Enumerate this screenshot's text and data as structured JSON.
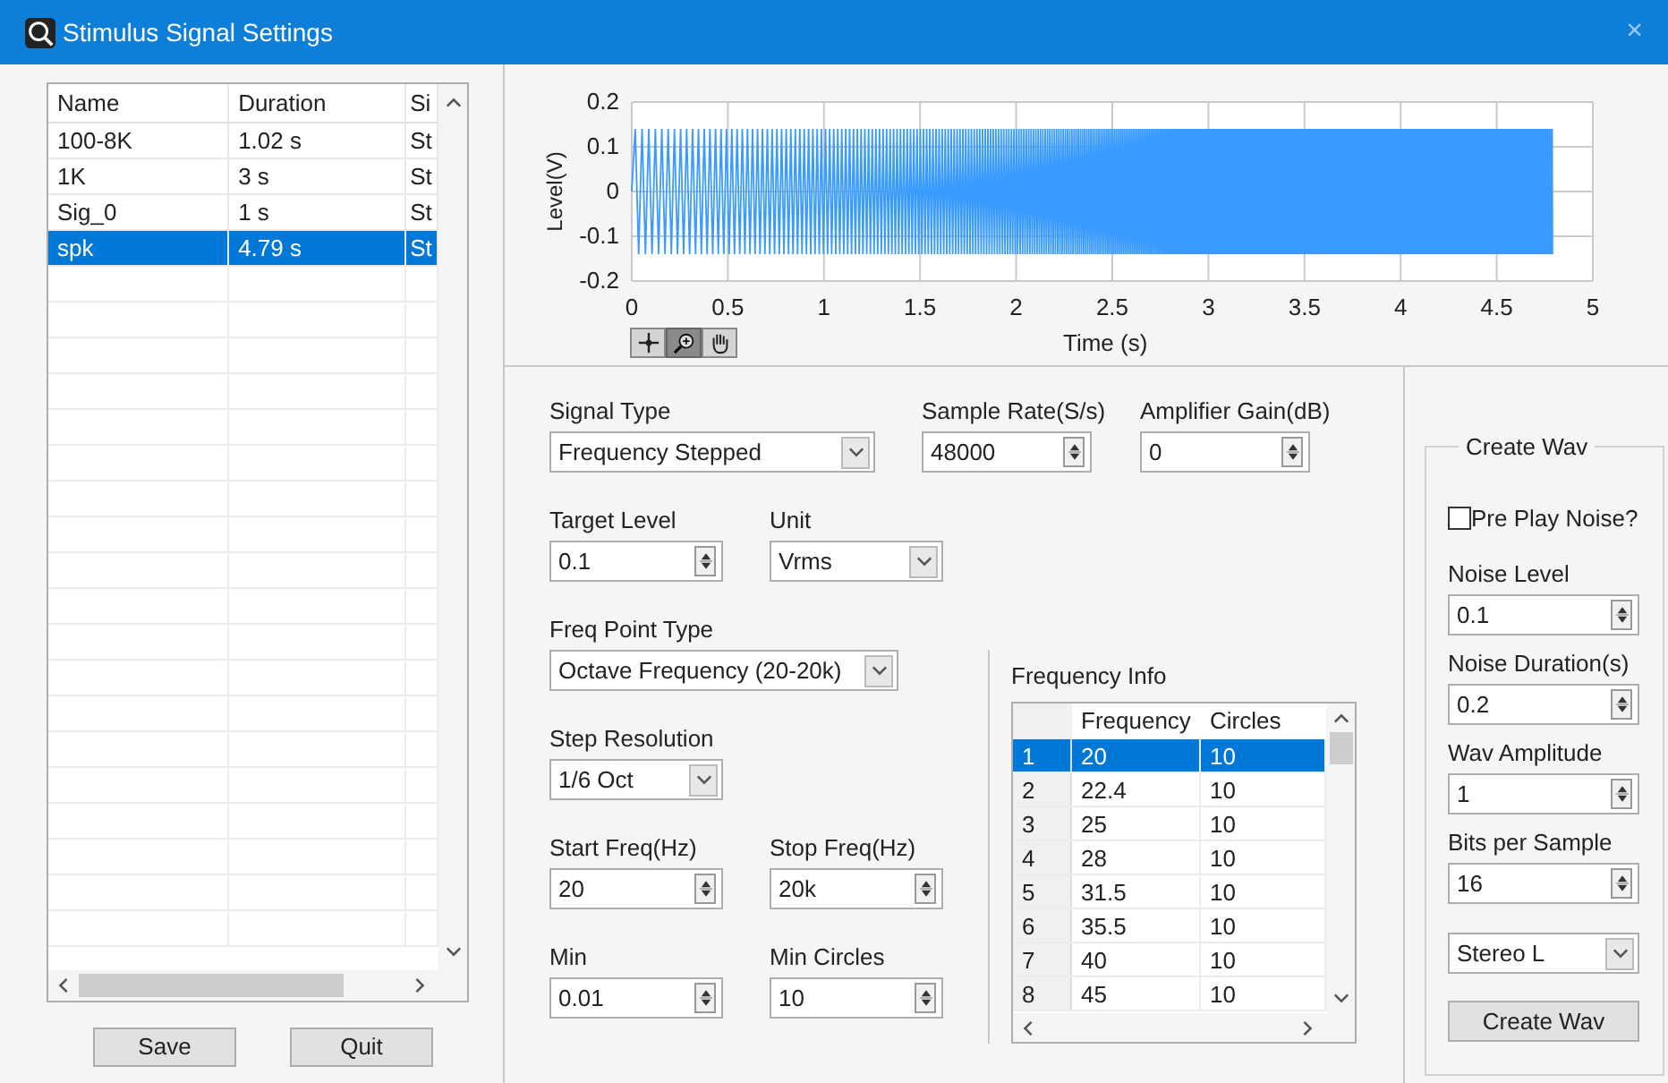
{
  "window": {
    "title": "Stimulus Signal Settings",
    "close": "×"
  },
  "signal_list": {
    "columns": [
      "Name",
      "Duration",
      "Si"
    ],
    "rows": [
      {
        "cells": [
          "100-8K",
          "1.02 s",
          "St"
        ],
        "selected": false
      },
      {
        "cells": [
          "1K",
          "3 s",
          "St"
        ],
        "selected": false
      },
      {
        "cells": [
          "Sig_0",
          "1 s",
          "St"
        ],
        "selected": false
      },
      {
        "cells": [
          "spk",
          "4.79 s",
          "St"
        ],
        "selected": true
      }
    ]
  },
  "buttons": [
    "Save",
    "Quit"
  ],
  "graph": {
    "ylabel": "Level(V)",
    "xlabel": "Time (s)",
    "yticks": [
      "0.2",
      "0.1",
      "0",
      "-0.1",
      "-0.2"
    ],
    "xticks": [
      "0",
      "0.5",
      "1",
      "1.5",
      "2",
      "2.5",
      "3",
      "3.5",
      "4",
      "4.5",
      "5"
    ]
  },
  "form": {
    "rows": [
      [
        {
          "kind": "dropdown",
          "label": "Signal Type",
          "value": "Frequency Stepped"
        },
        {
          "kind": "spinner",
          "label": "Sample Rate(S/s)",
          "value": "48000"
        },
        {
          "kind": "spinner",
          "label": "Amplifier Gain(dB)",
          "value": "0"
        }
      ],
      [
        {
          "kind": "spinner",
          "label": "Target Level",
          "value": "0.1"
        },
        {
          "kind": "dropdown",
          "label": "Unit",
          "value": "Vrms"
        }
      ],
      [
        {
          "kind": "dropdown",
          "label": "Freq Point Type",
          "value": "Octave Frequency (20-20k)"
        }
      ],
      [
        {
          "kind": "dropdown",
          "label": "Step Resolution",
          "value": "1/6 Oct"
        }
      ],
      [
        {
          "kind": "spinner",
          "label": "Start Freq(Hz)",
          "value": "20"
        },
        {
          "kind": "spinner",
          "label": "Stop Freq(Hz)",
          "value": "20k"
        }
      ],
      [
        {
          "kind": "spinner",
          "label": "Min",
          "value": "0.01"
        },
        {
          "kind": "spinner",
          "label": "Min Circles",
          "value": "10"
        }
      ]
    ]
  },
  "frequency_info": {
    "title": "Frequency Info",
    "columns": [
      "Frequency",
      "Circles"
    ],
    "rows": [
      {
        "index": "1",
        "cells": [
          "20",
          "10"
        ],
        "selected": true
      },
      {
        "index": "2",
        "cells": [
          "22.4",
          "10"
        ],
        "selected": false
      },
      {
        "index": "3",
        "cells": [
          "25",
          "10"
        ],
        "selected": false
      },
      {
        "index": "4",
        "cells": [
          "28",
          "10"
        ],
        "selected": false
      },
      {
        "index": "5",
        "cells": [
          "31.5",
          "10"
        ],
        "selected": false
      },
      {
        "index": "6",
        "cells": [
          "35.5",
          "10"
        ],
        "selected": false
      },
      {
        "index": "7",
        "cells": [
          "40",
          "10"
        ],
        "selected": false
      },
      {
        "index": "8",
        "cells": [
          "45",
          "10"
        ],
        "selected": false
      }
    ]
  },
  "create_wav": {
    "title": "Create Wav",
    "pre_play_noise": {
      "label": "Pre Play Noise?",
      "checked": false
    },
    "fields": [
      {
        "kind": "spinner",
        "label": "Noise Level",
        "value": "0.1"
      },
      {
        "kind": "spinner",
        "label": "Noise Duration(s)",
        "value": "0.2"
      },
      {
        "kind": "spinner",
        "label": "Wav Amplitude",
        "value": "1"
      },
      {
        "kind": "spinner",
        "label": "Bits per Sample",
        "value": "16"
      },
      {
        "kind": "dropdown",
        "value": "Stereo L"
      }
    ],
    "button": "Create Wav"
  }
}
